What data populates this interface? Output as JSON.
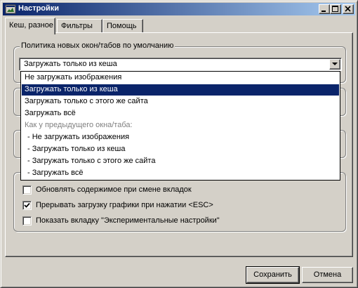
{
  "window": {
    "title": "Настройки",
    "controls": [
      "minimize-icon",
      "maximize-icon",
      "close-icon"
    ]
  },
  "tabs": [
    {
      "label": "Кеш, разное",
      "active": true
    },
    {
      "label": "Фильтры",
      "active": false
    },
    {
      "label": "Помощь",
      "active": false
    }
  ],
  "policy": {
    "group_label": "Политика новых окон/табов по умолчанию",
    "selected_value": "Загружать только из кеша",
    "options": [
      {
        "label": "Не загружать изображения",
        "selected": false,
        "disabled": false
      },
      {
        "label": "Загружать только из кеша",
        "selected": true,
        "disabled": false
      },
      {
        "label": "Загружать только с этого же сайта",
        "selected": false,
        "disabled": false
      },
      {
        "label": "Загружать всё",
        "selected": false,
        "disabled": false
      },
      {
        "label": "Как у предыдущего окна/таба:",
        "selected": false,
        "disabled": true
      },
      {
        "label": "- Не загружать изображения",
        "selected": false,
        "disabled": false
      },
      {
        "label": "- Загружать только из кеша",
        "selected": false,
        "disabled": false
      },
      {
        "label": "- Загружать только с этого же сайта",
        "selected": false,
        "disabled": false
      },
      {
        "label": "- Загружать всё",
        "selected": false,
        "disabled": false
      }
    ]
  },
  "checkboxes": [
    {
      "label": "Обновлять содержимое при смене вкладок",
      "checked": false
    },
    {
      "label": "Прерывать загрузку графики при нажатии <ESC>",
      "checked": true
    },
    {
      "label": "Показать вкладку \"Экспериментальные настройки\"",
      "checked": false
    }
  ],
  "buttons": {
    "save": "Сохранить",
    "cancel": "Отмена"
  },
  "colors": {
    "face": "#d4d0c8",
    "selection": "#0a246a",
    "titlebar_start": "#0a246a",
    "titlebar_end": "#a6caf0"
  }
}
